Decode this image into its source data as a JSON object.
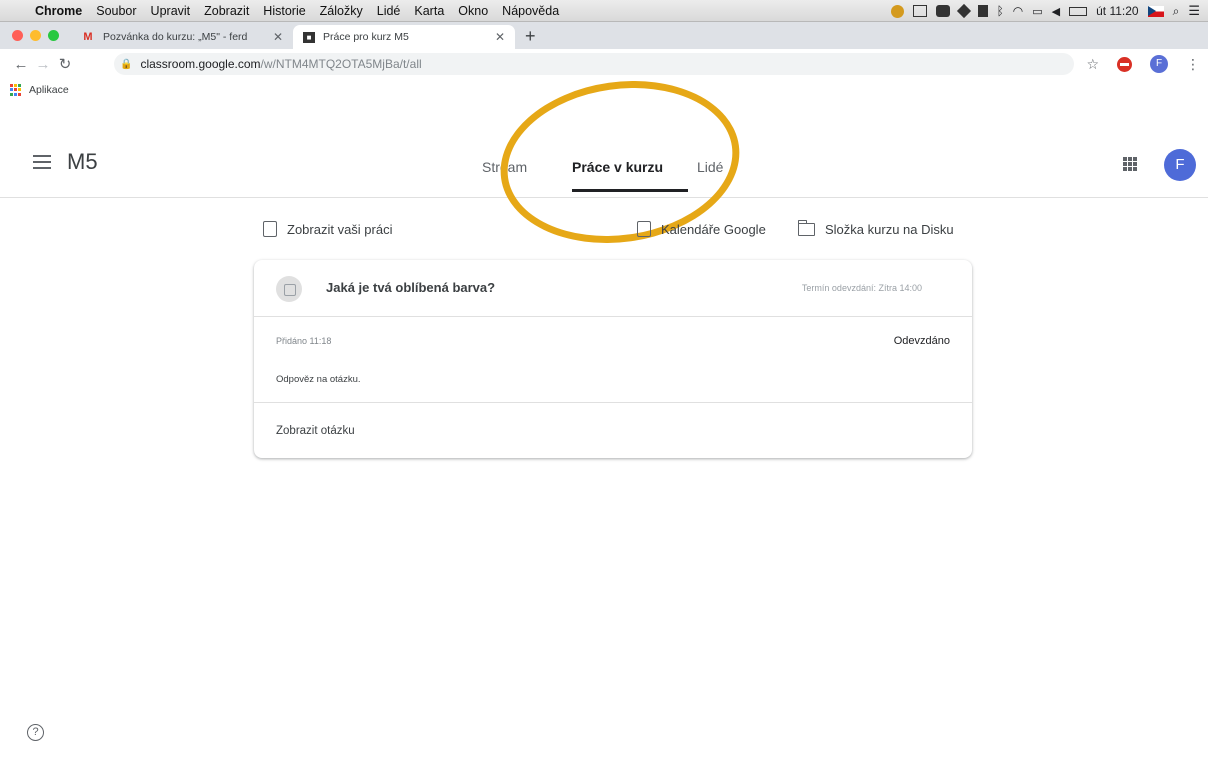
{
  "menubar": {
    "items": [
      "Chrome",
      "Soubor",
      "Upravit",
      "Zobrazit",
      "Historie",
      "Záložky",
      "Lidé",
      "Karta",
      "Okno",
      "Nápověda"
    ],
    "clock": "út 11:20"
  },
  "browser": {
    "tabs": [
      {
        "title": "Pozvánka do kurzu: „M5\" - ferd",
        "favicon": "gmail-icon"
      },
      {
        "title": "Práce pro kurz M5",
        "favicon": "classroom-icon"
      }
    ],
    "url_domain": "classroom.google.com",
    "url_path": "/w/NTM4MTQ2OTA5MjBa/t/all",
    "profile_initial": "F",
    "bookmarks": {
      "apps_label": "Aplikace"
    }
  },
  "classroom": {
    "course_name": "M5",
    "tabs": [
      "Stream",
      "Práce v kurzu",
      "Lidé"
    ],
    "profile_initial": "F",
    "actions": {
      "view_work": "Zobrazit vaši práci",
      "calendar": "Kalendáře Google",
      "drive_folder": "Složka kurzu na Disku"
    },
    "assignment": {
      "title": "Jaká je tvá oblíbená barva?",
      "due": "Termín odevzdání: Zítra 14:00",
      "added": "Přidáno 11:18",
      "status": "Odevzdáno",
      "instructions": "Odpověz na otázku.",
      "view_label": "Zobrazit otázku"
    }
  },
  "colors": {
    "highlight": "#e6a817",
    "accent": "#4e6bd8"
  }
}
